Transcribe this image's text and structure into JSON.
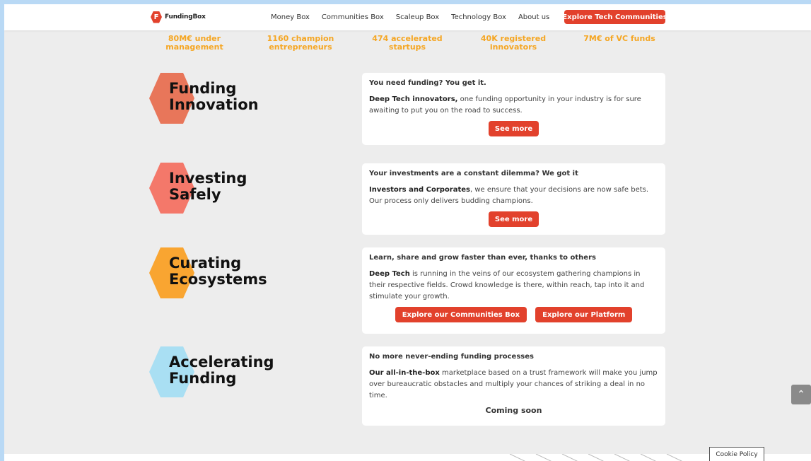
{
  "header": {
    "logo_icon": "F",
    "logo_text": "FundingBox",
    "nav": [
      "Money Box",
      "Communities Box",
      "Scaleup Box",
      "Technology Box",
      "About us"
    ],
    "cta": "Explore Tech Communities"
  },
  "stats": [
    {
      "line1": "80M€ under",
      "line2": "management"
    },
    {
      "line1": "1160 champion",
      "line2": "entrepreneurs"
    },
    {
      "line1": "474 accelerated",
      "line2": "startups"
    },
    {
      "line1": "40K registered",
      "line2": "innovators"
    },
    {
      "line1": "7M€ of VC funds",
      "line2": ""
    }
  ],
  "sections": [
    {
      "title1": "Funding",
      "title2": "Innovation",
      "hex_color": "#e8765a",
      "heading": "You need funding? You get it.",
      "lead": "Deep Tech innovators,",
      "text": " one funding opportunity in your industry is for sure awaiting to put you on the road to success.",
      "button": "See more"
    },
    {
      "title1": "Investing",
      "title2": "Safely",
      "hex_color": "#f4786a",
      "heading": "Your investments are a constant dilemma? We got it",
      "lead": "Investors and Corporates",
      "text": ", we ensure that your decisions are now safe bets. Our process only delivers budding champions.",
      "button": "See more"
    },
    {
      "title1": "Curating",
      "title2": "Ecosystems",
      "hex_color": "#f9a531",
      "heading": "Learn, share and grow faster than ever, thanks to others",
      "lead": "Deep Tech",
      "text": " is running in the veins of our ecosystem gathering champions in their respective fields. Crowd knowledge is there, within reach, tap into it and stimulate your growth.",
      "button": "Explore our Communities Box",
      "button2": "Explore our Platform"
    },
    {
      "title1": "Accelerating",
      "title2": "Funding",
      "hex_color": "#a9dff3",
      "heading": "No more never-ending funding processes",
      "lead": "Our all-in-the-box",
      "text": " marketplace based on a trust framework will make you jump over bureaucratic obstacles and multiply your chances of striking a deal in no time.",
      "coming": "Coming soon"
    }
  ],
  "scroll_top_icon": "chevron-up-icon",
  "cookie": "Cookie Policy",
  "colors": {
    "accent": "#e2412c",
    "stats": "#f5a623"
  }
}
